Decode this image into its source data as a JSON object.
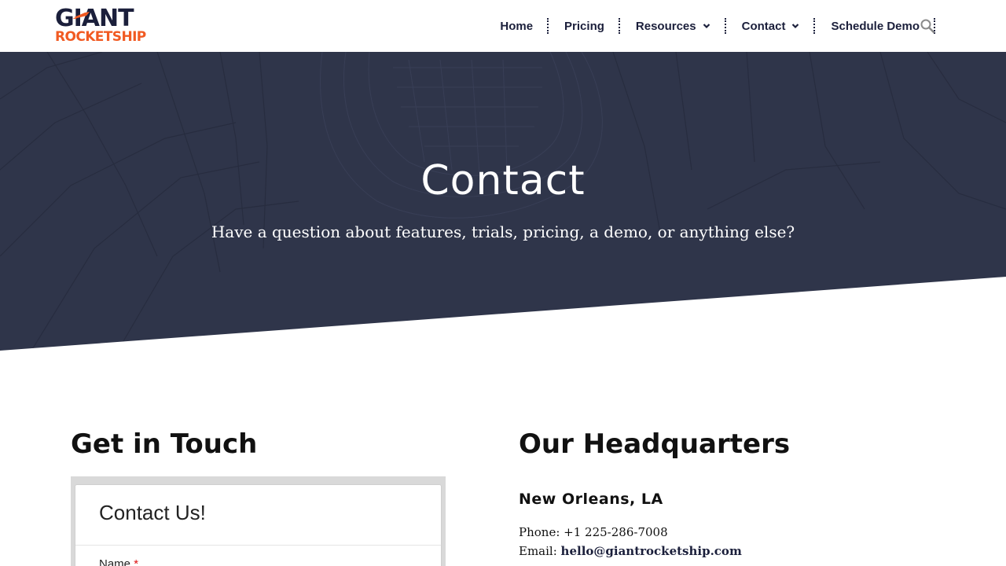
{
  "brand": {
    "line1": "GIANT",
    "line2": "ROCKETSHIP",
    "accent": "#f15a22",
    "navy": "#1b1f3b"
  },
  "nav": {
    "items": [
      {
        "label": "Home"
      },
      {
        "label": "Pricing"
      },
      {
        "label": "Resources"
      },
      {
        "label": "Contact"
      },
      {
        "label": "Schedule Demo"
      }
    ],
    "search_icon": "search-icon"
  },
  "hero": {
    "title": "Contact",
    "subtitle": "Have a question about features, trials, pricing, a demo, or anything else?"
  },
  "left": {
    "heading": "Get in Touch",
    "form": {
      "title": "Contact Us!",
      "name_label": "Name",
      "required_mark": "*"
    }
  },
  "right": {
    "heading": "Our Headquarters",
    "city": "New Orleans, LA",
    "phone_label": "Phone:",
    "phone": "+1 225-286-7008",
    "email_label": "Email:",
    "email": "hello@giantrocketship.com"
  }
}
